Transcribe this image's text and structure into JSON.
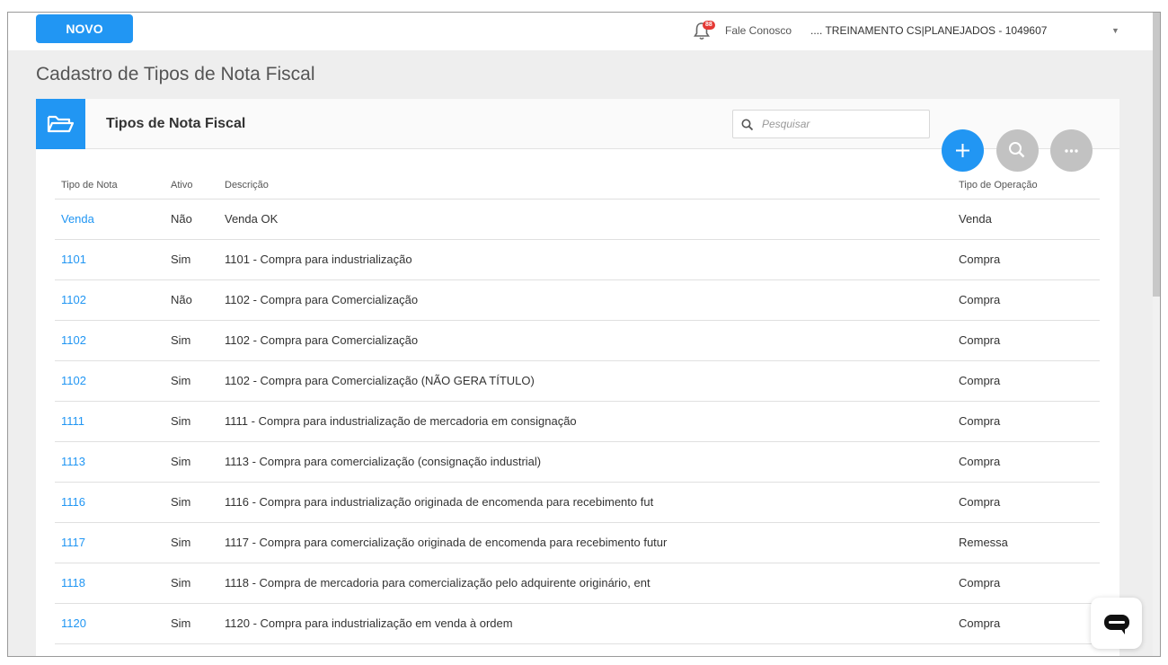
{
  "topbar": {
    "new_button": "NOVO",
    "notification_count": "88",
    "contact_link": "Fale Conosco",
    "company_selector": ".... TREINAMENTO CS|PLANEJADOS - 1049607"
  },
  "page_title": "Cadastro de Tipos de Nota Fiscal",
  "card": {
    "title": "Tipos de Nota Fiscal",
    "search_placeholder": "Pesquisar"
  },
  "table": {
    "headers": {
      "tipo": "Tipo de Nota",
      "ativo": "Ativo",
      "descricao": "Descrição",
      "operacao": "Tipo de Operação"
    },
    "rows": [
      {
        "tipo": "Venda",
        "ativo": "Não",
        "descricao": "Venda OK",
        "operacao": "Venda"
      },
      {
        "tipo": "1101",
        "ativo": "Sim",
        "descricao": "1101 - Compra para industrialização",
        "operacao": "Compra"
      },
      {
        "tipo": "1102",
        "ativo": "Não",
        "descricao": "1102 - Compra para Comercialização",
        "operacao": "Compra"
      },
      {
        "tipo": "1102",
        "ativo": "Sim",
        "descricao": "1102 - Compra para Comercialização",
        "operacao": "Compra"
      },
      {
        "tipo": "1102",
        "ativo": "Sim",
        "descricao": "1102 - Compra para Comercialização (NÃO GERA TÍTULO)",
        "operacao": "Compra"
      },
      {
        "tipo": "1111",
        "ativo": "Sim",
        "descricao": "1111 - Compra para industrialização de mercadoria em consignação",
        "operacao": "Compra"
      },
      {
        "tipo": "1113",
        "ativo": "Sim",
        "descricao": "1113 - Compra para comercialização (consignação industrial)",
        "operacao": "Compra"
      },
      {
        "tipo": "1116",
        "ativo": "Sim",
        "descricao": "1116 - Compra para industrialização originada de encomenda para recebimento fut",
        "operacao": "Compra"
      },
      {
        "tipo": "1117",
        "ativo": "Sim",
        "descricao": "1117 - Compra para comercialização originada de encomenda para recebimento futur",
        "operacao": "Remessa"
      },
      {
        "tipo": "1118",
        "ativo": "Sim",
        "descricao": "1118 - Compra de mercadoria para comercialização pelo adquirente originário, ent",
        "operacao": "Compra"
      },
      {
        "tipo": "1120",
        "ativo": "Sim",
        "descricao": "1120 - Compra para industrialização em venda à ordem",
        "operacao": "Compra"
      }
    ]
  },
  "colors": {
    "primary": "#2196f3",
    "fab_gray": "#c2c2c2",
    "badge": "#e53935"
  }
}
